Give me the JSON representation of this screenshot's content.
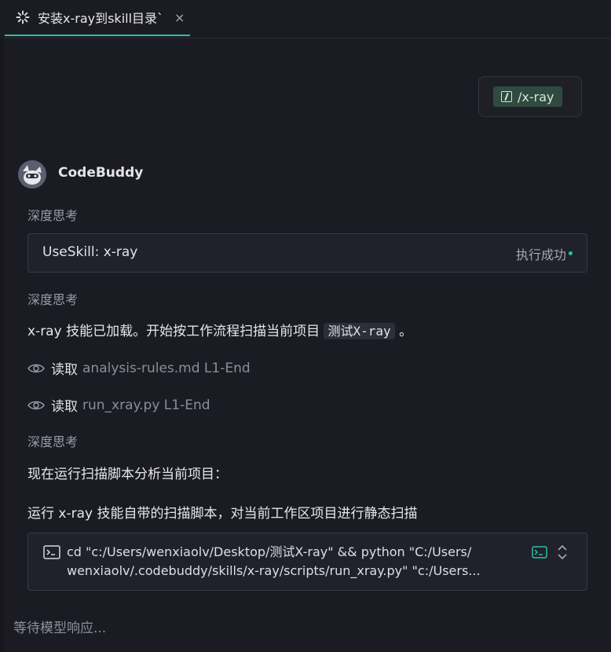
{
  "tab": {
    "title": "安装x-ray到skill目录`",
    "close": "×"
  },
  "user_message": {
    "chip_text": "/x-ray"
  },
  "assistant": {
    "name": "CodeBuddy",
    "think_label": "深度思考",
    "skill": {
      "name": "UseSkill: x-ray",
      "status": "执行成功"
    },
    "loaded_text_before": "x-ray 技能已加载。开始按工作流程扫描当前项目",
    "project_name": "测试X-ray",
    "loaded_text_after": "。",
    "reads": [
      {
        "verb": "读取",
        "file": "analysis-rules.md L1-End"
      },
      {
        "verb": "读取",
        "file": "run_xray.py L1-End"
      }
    ],
    "run_intro": "现在运行扫描脚本分析当前项目：",
    "run_desc": "运行 x-ray 技能自带的扫描脚本，对当前工作区项目进行静态扫描",
    "command": {
      "line1": "cd \"c:/Users/wenxiaolv/Desktop/测试X-ray\" && python \"C:/Users/",
      "line2": "wenxiaolv/.codebuddy/skills/x-ray/scripts/run_xray.py\" \"c:/Users..."
    }
  },
  "status": {
    "waiting": "等待模型响应..."
  },
  "colors": {
    "accent": "#26c3a1",
    "background": "#1b1b23"
  },
  "icons": [
    "loading-spinner-icon",
    "close-icon",
    "slash-command-icon",
    "avatar",
    "eye-icon",
    "terminal-icon",
    "run-terminal-icon",
    "expand-collapse-icon"
  ]
}
